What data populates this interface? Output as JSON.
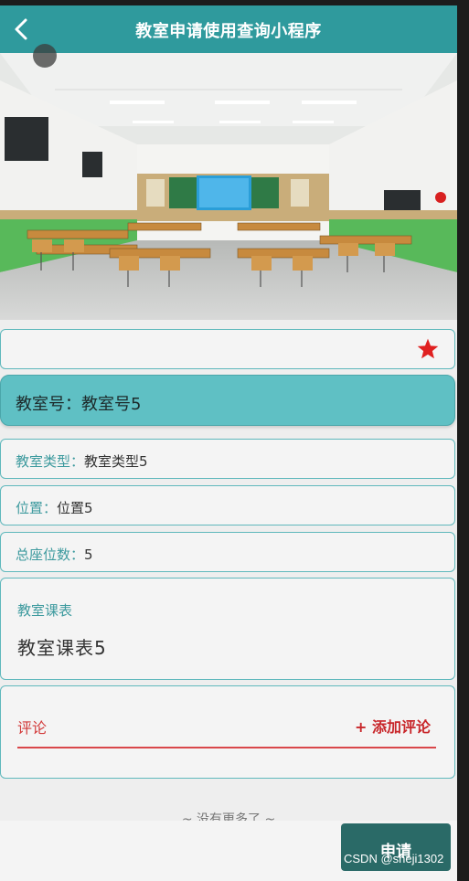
{
  "navbar": {
    "title": "教室申请使用查询小程序"
  },
  "room": {
    "label": "教室号：",
    "value": "教室号5"
  },
  "info_rows": {
    "type": {
      "label": "教室类型",
      "sep": "：",
      "value": "教室类型5"
    },
    "position": {
      "label": "位置",
      "sep": "：",
      "value": "位置5"
    },
    "seats": {
      "label": "总座位数",
      "sep": "：",
      "value": "5"
    }
  },
  "schedule": {
    "title": "教室课表",
    "value": "教室课表5"
  },
  "comments": {
    "label": "评论",
    "add_label": "+ 添加评论"
  },
  "footer": {
    "no_more": "~ 没有更多了 ~",
    "apply_label": "申请"
  },
  "watermark": "CSDN @sheji1302",
  "icons": {
    "back": "back-arrow-icon",
    "favorite": "star-icon"
  },
  "colors": {
    "primary": "#2f9a9d",
    "accent": "#5fc0c4",
    "favorite": "#e02020",
    "comment": "#d23a3a"
  }
}
